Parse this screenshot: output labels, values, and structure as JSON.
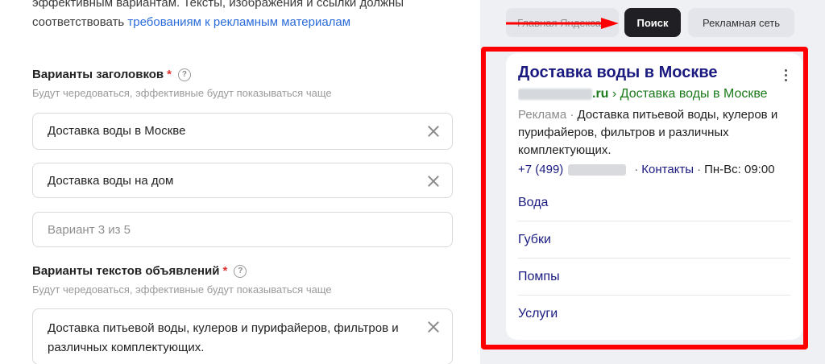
{
  "form": {
    "intro_text": "эффективным вариантам. Тексты, изображения и ссылки должны соответствовать ",
    "intro_link": "требованиям к рекламным материалам",
    "headlines": {
      "title": "Варианты заголовков",
      "required_mark": "*",
      "hint": "Будут чередоваться, эффективные будут показываться чаще",
      "items": [
        {
          "value": "Доставка воды в Москве"
        },
        {
          "value": "Доставка воды на дом"
        }
      ],
      "placeholder": "Вариант 3 из 5"
    },
    "texts": {
      "title": "Варианты текстов объявлений",
      "required_mark": "*",
      "hint": "Будут чередоваться, эффективные будут показываться чаще",
      "items": [
        {
          "value": "Доставка питьевой воды, кулеров и пурифайеров, фильтров и различных комплектующих."
        }
      ]
    }
  },
  "preview": {
    "tabs": [
      {
        "label": "Главная Яндекса"
      },
      {
        "label": "Поиск",
        "active": true
      },
      {
        "label": "Рекламная сеть"
      }
    ],
    "ad": {
      "title": "Доставка воды в Москве",
      "domain_ext": ".ru",
      "separator": "›",
      "path": "Доставка воды в Москве",
      "label": "Реклама ·",
      "description": "Доставка питьевой воды, кулеров и пурифайеров, фильтров и различных комплектующих.",
      "phone_prefix": "+7 (499)",
      "contacts": "Контакты",
      "hours": "Пн-Вс: 09:00",
      "dot": "·",
      "sitelinks": [
        "Вода",
        "Губки",
        "Помпы",
        "Услуги"
      ]
    }
  },
  "colors": {
    "highlight": "#ff0000",
    "active_tab": "#1f1f24",
    "link_blue": "#1a1a80",
    "url_green": "#1a7a1a",
    "required": "#e03030"
  }
}
